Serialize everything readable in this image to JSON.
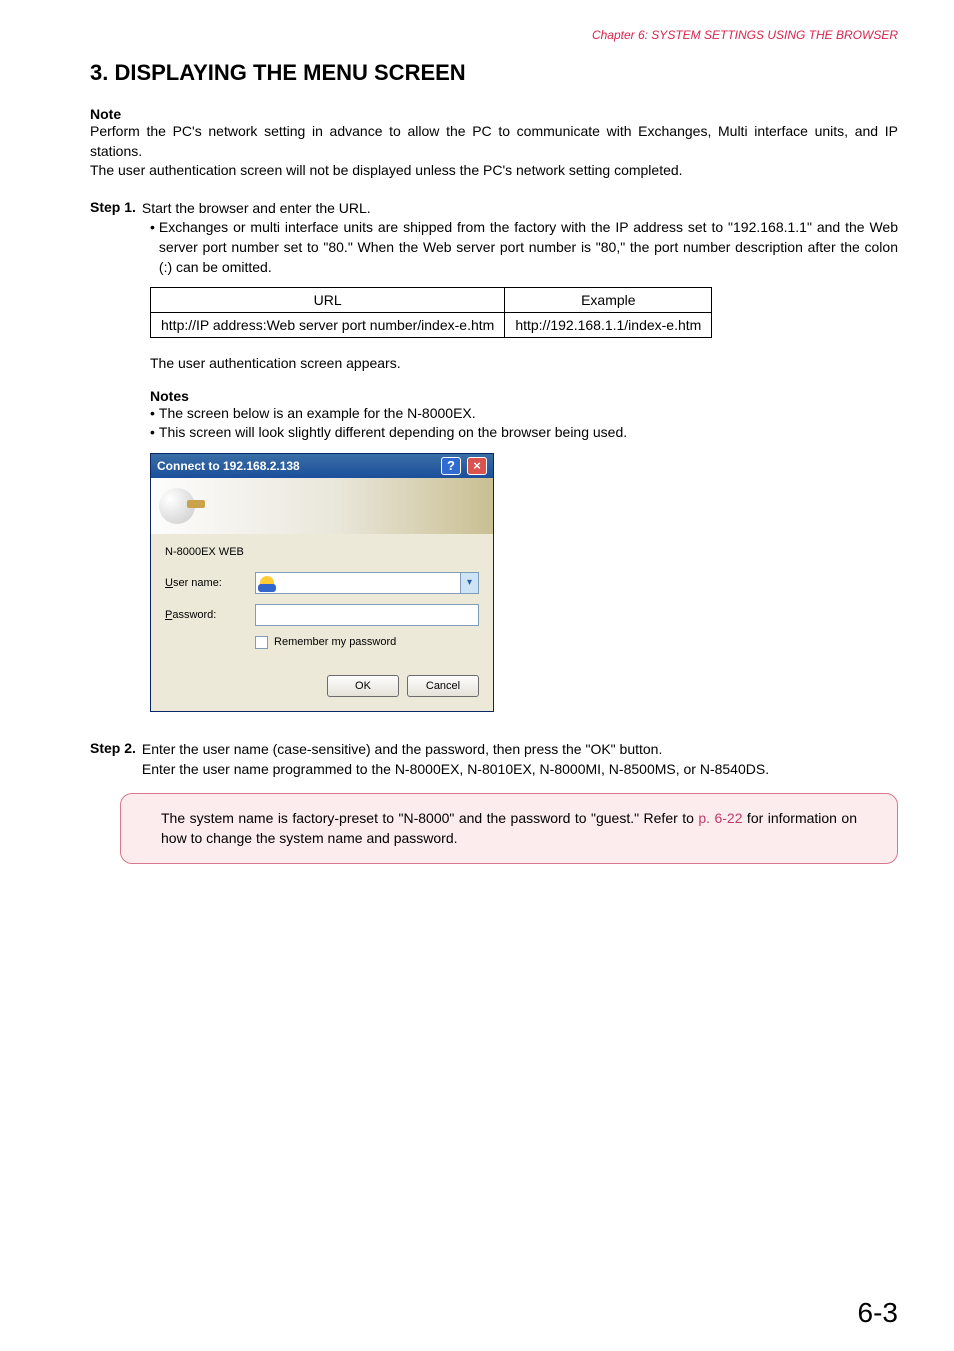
{
  "header": {
    "chapter_line": "Chapter 6:  SYSTEM SETTINGS USING THE BROWSER"
  },
  "title": "3. DISPLAYING THE MENU SCREEN",
  "note": {
    "label": "Note",
    "p1": "Perform the PC's network setting in advance to allow the PC to communicate with Exchanges, Multi interface units, and IP stations.",
    "p2": "The user authentication screen will not be displayed unless the PC's network setting completed."
  },
  "step1": {
    "label": "Step 1.",
    "lead": "Start the browser and enter the URL.",
    "bullet": "Exchanges or multi interface units are shipped from the factory with the IP address set to \"192.168.1.1\" and the Web server port number set to \"80.\" When the Web server port number is \"80,\" the port number description after the colon (:) can be omitted.",
    "table": {
      "h1": "URL",
      "h2": "Example",
      "c1": "http://IP address:Web server port number/index-e.htm",
      "c2": "http://192.168.1.1/index-e.htm"
    },
    "after_table": "The user authentication screen appears.",
    "notes_label": "Notes",
    "notes_b1": "The screen below is an example for the N-8000EX.",
    "notes_b2": "This screen will look slightly different depending on the browser being used."
  },
  "dialog": {
    "title": "Connect to 192.168.2.138",
    "realm": "N-8000EX WEB",
    "user_prefix": "U",
    "user_rest": "ser name:",
    "pass_prefix": "P",
    "pass_rest": "assword:",
    "remember_prefix": "R",
    "remember_rest": "emember my password",
    "ok": "OK",
    "cancel": "Cancel"
  },
  "step2": {
    "label": "Step 2.",
    "line1": "Enter the user name (case-sensitive) and the password, then press the \"OK\" button.",
    "line2": "Enter the user name programmed to the N-8000EX, N-8010EX, N-8000MI, N-8500MS, or N-8540DS."
  },
  "callout": {
    "text_before_link": "The system name is factory-preset to \"N-8000\" and the password to \"guest.\" Refer to ",
    "link": "p. 6-22",
    "text_after_link": " for information on how to change the system name and password."
  },
  "page_number": "6-3"
}
